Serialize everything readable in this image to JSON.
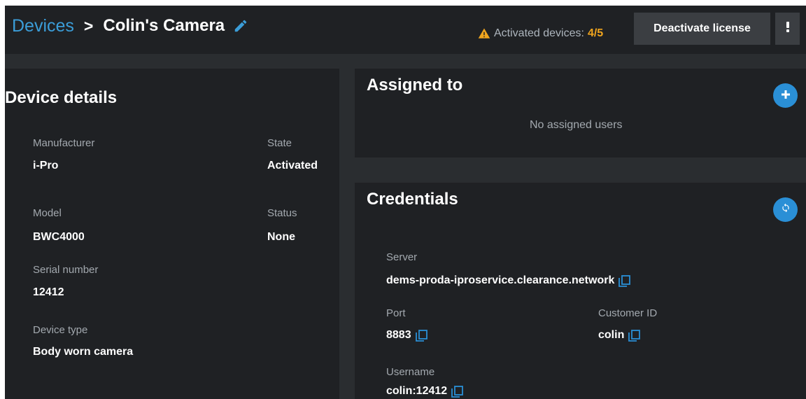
{
  "header": {
    "breadcrumb_root": "Devices",
    "breadcrumb_separator": ">",
    "device_name": "Colin's Camera",
    "activated_label": "Activated devices:",
    "activated_count": "4/5",
    "deactivate_label": "Deactivate license",
    "menu_icon": "kebab-menu-icon"
  },
  "device_details": {
    "title": "Device details",
    "manufacturer": {
      "label": "Manufacturer",
      "value": "i-Pro"
    },
    "state": {
      "label": "State",
      "value": "Activated"
    },
    "model": {
      "label": "Model",
      "value": "BWC4000"
    },
    "status": {
      "label": "Status",
      "value": "None"
    },
    "serial": {
      "label": "Serial number",
      "value": "12412"
    },
    "device_type": {
      "label": "Device type",
      "value": "Body worn camera"
    }
  },
  "assigned": {
    "title": "Assigned to",
    "empty_text": "No assigned users",
    "add_icon": "plus-icon"
  },
  "credentials": {
    "title": "Credentials",
    "refresh_icon": "refresh-icon",
    "server": {
      "label": "Server",
      "value": "dems-proda-iproservice.clearance.network"
    },
    "port": {
      "label": "Port",
      "value": "8883"
    },
    "customer_id": {
      "label": "Customer ID",
      "value": "colin"
    },
    "username": {
      "label": "Username",
      "value": "colin:12412"
    }
  },
  "colors": {
    "accent": "#2a8fd6",
    "warning": "#f0a51e",
    "panel": "#1f2124",
    "background": "#2a2d30"
  }
}
